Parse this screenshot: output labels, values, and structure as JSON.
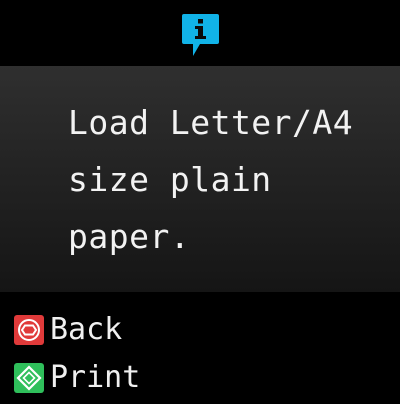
{
  "header": {
    "icon": "info-speech-bubble-icon",
    "icon_color": "#11b3e8"
  },
  "message": {
    "text": "Load Letter/A4\nsize plain\npaper."
  },
  "footer": {
    "back": {
      "label": "Back",
      "icon": "stop-button-icon",
      "icon_color": "#e03a3a"
    },
    "print": {
      "label": "Print",
      "icon": "start-button-icon",
      "icon_color": "#2fbf5b"
    }
  }
}
